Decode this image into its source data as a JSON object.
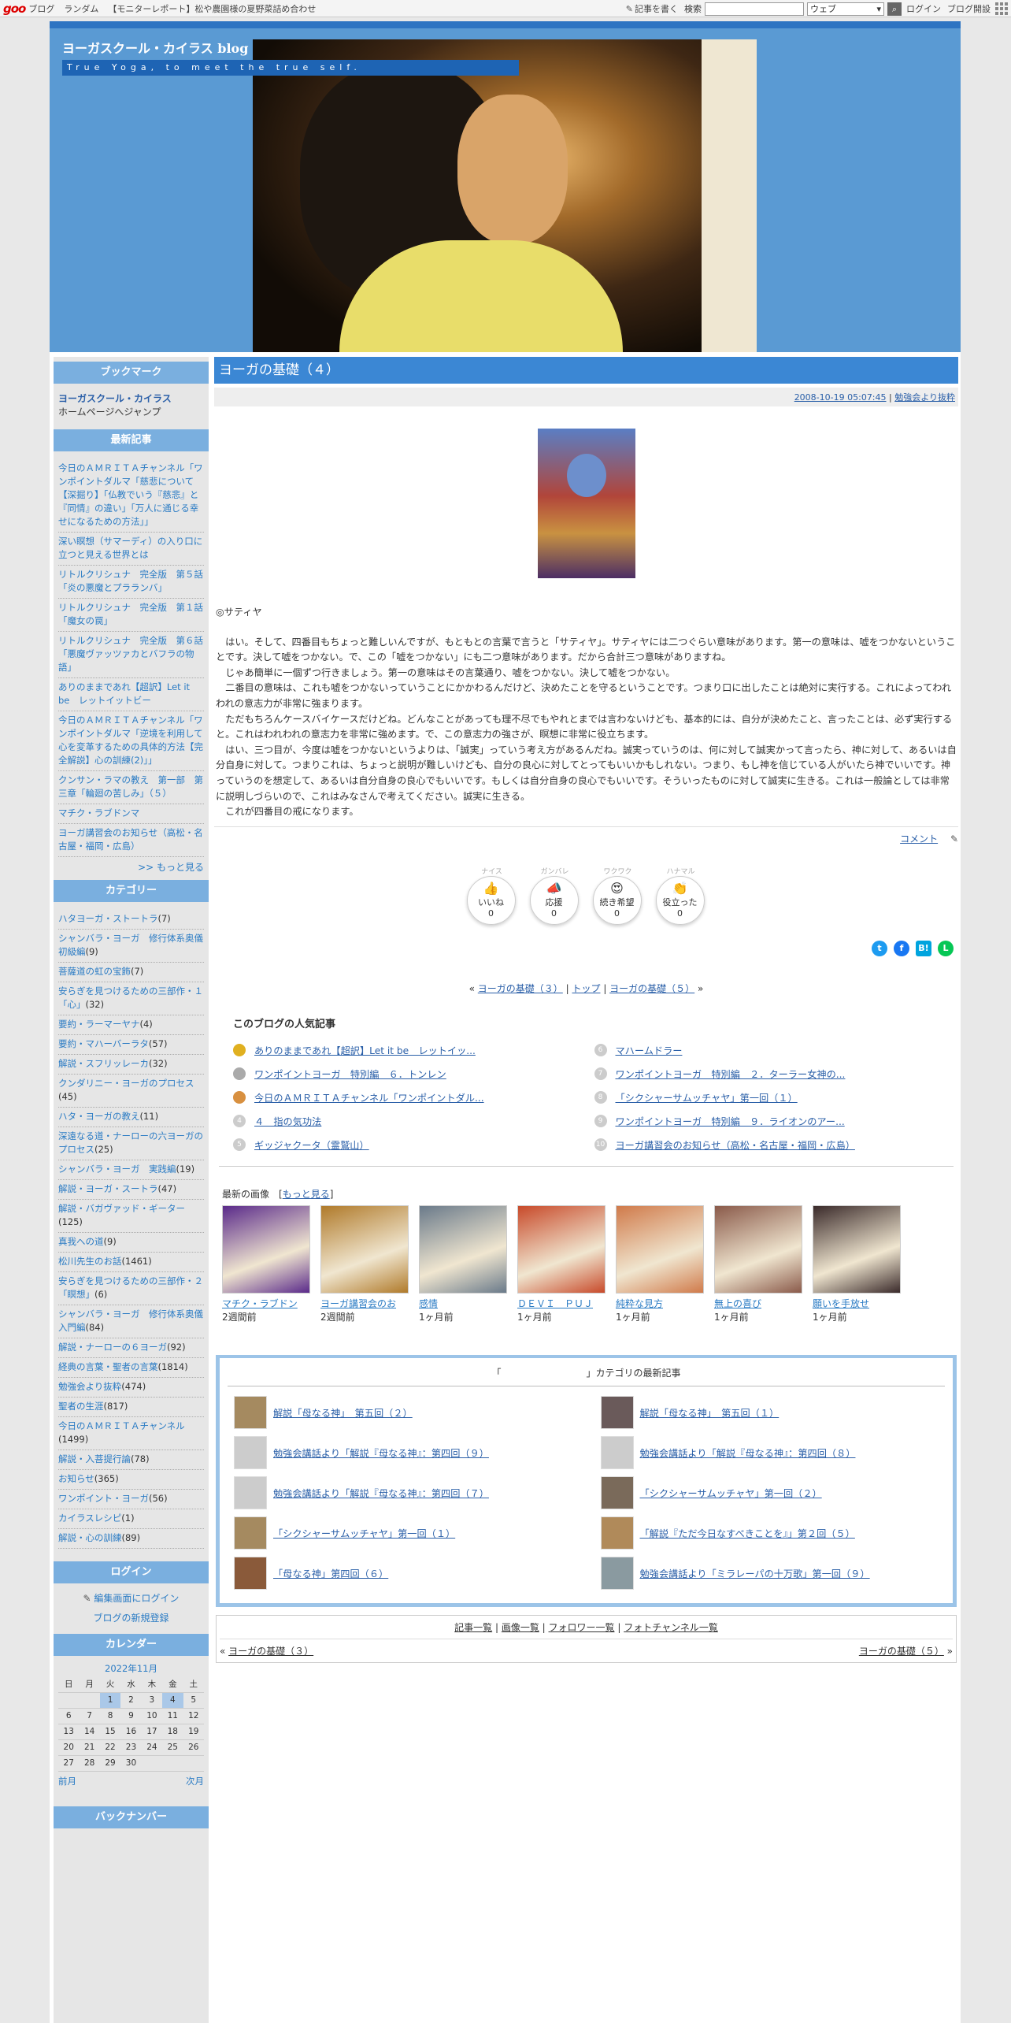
{
  "topbar": {
    "logo": "goo",
    "links": [
      "ブログ",
      "ランダム",
      "【モニターレポート】松や農園様の夏野菜詰め合わせ"
    ],
    "write": "記事を書く",
    "search_label": "検索",
    "search_value": "",
    "select_value": "ウェブ",
    "login": "ログイン",
    "open_blog": "ブログ開設"
  },
  "header": {
    "title": "ヨーガスクール・カイラス blog",
    "subtitle": "True Yoga, to meet the true self."
  },
  "sidebar": {
    "bookmark": {
      "heading": "ブックマーク",
      "link": "ヨーガスクール・カイラス",
      "note": "ホームページへジャンプ"
    },
    "recent": {
      "heading": "最新記事",
      "items": [
        "今日のＡＭＲＩＴＡチャンネル「ワンポイントダルマ「慈悲について【深掘り】「仏教でいう『慈悲』と『同情』の違い」「万人に通じる幸せになるための方法」」",
        "深い瞑想（サマーディ）の入り口に立つと見える世界とは",
        "リトルクリシュナ　完全版　第５話「炎の悪魔とプラランバ」",
        "リトルクリシュナ　完全版　第１話「魔女の罠」",
        "リトルクリシュナ　完全版　第６話「悪魔ヴァッツァカとバフラの物語」",
        "ありのままであれ【超訳】Let it be　レットイットビー",
        "今日のＡＭＲＩＴＡチャンネル「ワンポイントダルマ「逆境を利用して心を変革するための具体的方法【完全解説】心の訓練(2)」」",
        "クンサン・ラマの教え　第一部　第三章「輪廻の苦しみ」（５）",
        "マチク・ラブドンマ",
        "ヨーガ講習会のお知らせ（高松・名古屋・福岡・広島）"
      ],
      "more": ">> もっと見る"
    },
    "categories": {
      "heading": "カテゴリー",
      "items": [
        {
          "name": "ハタヨーガ・ストートラ",
          "count": "(7)"
        },
        {
          "name": "シャンバラ・ヨーガ　修行体系奥儀　初級編",
          "count": "(9)"
        },
        {
          "name": "菩薩道の虹の宝飾",
          "count": "(7)"
        },
        {
          "name": "安らぎを見つけるための三部作・１「心」",
          "count": "(32)"
        },
        {
          "name": "要約・ラーマーヤナ",
          "count": "(4)"
        },
        {
          "name": "要約・マハーバーラタ",
          "count": "(57)"
        },
        {
          "name": "解説・スフリッレーカ",
          "count": "(32)"
        },
        {
          "name": "クンダリニー・ヨーガのプロセス",
          "count": "(45)"
        },
        {
          "name": "ハタ・ヨーガの教え",
          "count": "(11)"
        },
        {
          "name": "深遠なる道・ナーローの六ヨーガのプロセス",
          "count": "(25)"
        },
        {
          "name": "シャンバラ・ヨーガ　実践編",
          "count": "(19)"
        },
        {
          "name": "解説・ヨーガ・スートラ",
          "count": "(47)"
        },
        {
          "name": "解説・バガヴァッド・ギーター",
          "count": "(125)"
        },
        {
          "name": "真我への道",
          "count": "(9)"
        },
        {
          "name": "松川先生のお話",
          "count": "(1461)"
        },
        {
          "name": "安らぎを見つけるための三部作・２「瞑想」",
          "count": "(6)"
        },
        {
          "name": "シャンバラ・ヨーガ　修行体系奥儀　入門編",
          "count": "(84)"
        },
        {
          "name": "解説・ナーローの６ヨーガ",
          "count": "(92)"
        },
        {
          "name": "経典の言葉・聖者の言葉",
          "count": "(1814)"
        },
        {
          "name": "勉強会より抜粋",
          "count": "(474)"
        },
        {
          "name": "聖者の生涯",
          "count": "(817)"
        },
        {
          "name": "今日のＡＭＲＩＴＡチャンネル",
          "count": "(1499)"
        },
        {
          "name": "解説・入菩提行論",
          "count": "(78)"
        },
        {
          "name": "お知らせ",
          "count": "(365)"
        },
        {
          "name": "ワンポイント・ヨーガ",
          "count": "(56)"
        },
        {
          "name": "カイラスレシピ",
          "count": "(1)"
        },
        {
          "name": "解説・心の訓練",
          "count": "(89)"
        }
      ]
    },
    "login": {
      "heading": "ログイン",
      "edit": "編集画面にログイン",
      "register": "ブログの新規登録"
    },
    "calendar": {
      "heading": "カレンダー",
      "month": "2022年11月",
      "weekdays": [
        "日",
        "月",
        "火",
        "水",
        "木",
        "金",
        "土"
      ],
      "weeks": [
        [
          "",
          "",
          "1",
          "2",
          "3",
          "4",
          "5"
        ],
        [
          "6",
          "7",
          "8",
          "9",
          "10",
          "11",
          "12"
        ],
        [
          "13",
          "14",
          "15",
          "16",
          "17",
          "18",
          "19"
        ],
        [
          "20",
          "21",
          "22",
          "23",
          "24",
          "25",
          "26"
        ],
        [
          "27",
          "28",
          "29",
          "30",
          "",
          "",
          ""
        ]
      ],
      "prev": "前月",
      "next": "次月"
    },
    "bottom_heading": "バックナンバー"
  },
  "post": {
    "title": "ヨーガの基礎（４）",
    "datetime": "2008-10-19 05:07:45",
    "category": "勉強会より抜粋",
    "section_title": "◎サティヤ",
    "paragraphs": [
      "　はい。そして、四番目もちょっと難しいんですが、もともとの言葉で言うと「サティヤ」。サティヤには二つぐらい意味があります。第一の意味は、嘘をつかないということです。決して嘘をつかない。で、この「嘘をつかない」にも二つ意味があります。だから合計三つ意味がありますね。",
      "　じゃあ簡単に一個ずつ行きましょう。第一の意味はその言葉通り、嘘をつかない。決して嘘をつかない。",
      "　二番目の意味は、これも嘘をつかないっていうことにかかわるんだけど、決めたことを守るということです。つまり口に出したことは絶対に実行する。これによってわれわれの意志力が非常に強まります。",
      "　ただもちろんケースバイケースだけどね。どんなことがあっても理不尽でもやれとまでは言わないけども、基本的には、自分が決めたこと、言ったことは、必ず実行すると。これはわれわれの意志力を非常に強めます。で、この意志力の強さが、瞑想に非常に役立ちます。",
      "　はい、三つ目が、今度は嘘をつかないというよりは、「誠実」っていう考え方があるんだね。誠実っていうのは、何に対して誠実かって言ったら、神に対して、あるいは自分自身に対して。つまりこれは、ちょっと説明が難しいけども、自分の良心に対してとってもいいかもしれない。つまり、もし神を信じている人がいたら神でいいです。神っていうのを想定して、あるいは自分自身の良心でもいいです。もしくは自分自身の良心でもいいです。そういったものに対して誠実に生きる。これは一般論としては非常に説明しづらいので、これはみなさんで考えてください。誠実に生きる。",
      "　これが四番目の戒になります。"
    ],
    "comment": "コメント",
    "reactions": [
      {
        "top": "ナイス",
        "emoji": "👍",
        "label": "いいね",
        "count": "0"
      },
      {
        "top": "ガンバレ",
        "emoji": "📣",
        "label": "応援",
        "count": "0"
      },
      {
        "top": "ワクワク",
        "emoji": "😍",
        "label": "続き希望",
        "count": "0"
      },
      {
        "top": "ハナマル",
        "emoji": "👏",
        "label": "役立った",
        "count": "0"
      }
    ],
    "share": [
      "t",
      "f",
      "B!",
      "L"
    ],
    "pager": {
      "prev": "ヨーガの基礎（３）",
      "top": "トップ",
      "next": "ヨーガの基礎（５）"
    }
  },
  "popular": {
    "heading": "このブログの人気記事",
    "left": [
      "ありのままであれ【超訳】Let it be　レットイッ...",
      "ワンポイントヨーガ　特別編　６．トンレン",
      "今日のＡＭＲＩＴＡチャンネル「ワンポイントダル...",
      "４　指の気功法",
      "ギッジャクータ（霊鷲山）"
    ],
    "right": [
      "マハームドラー",
      "ワンポイントヨーガ　特別編　２．ターラー女神の...",
      "「シクシャーサムッチャヤ」第一回（１）",
      "ワンポイントヨーガ　特別編　９．ライオンのアー...",
      "ヨーガ講習会のお知らせ（高松・名古屋・福岡・広島）"
    ],
    "ranks_left": [
      "",
      "",
      "",
      "4",
      "5"
    ],
    "ranks_right": [
      "6",
      "7",
      "8",
      "9",
      "10"
    ]
  },
  "images": {
    "heading": "最新の画像",
    "more": "もっと見る",
    "items": [
      {
        "title": "マチク・ラブドン",
        "age": "2週間前",
        "color": "#5a2a8a"
      },
      {
        "title": "ヨーガ講習会のお",
        "age": "2週間前",
        "color": "#b07a2a"
      },
      {
        "title": "感情",
        "age": "1ヶ月前",
        "color": "#6a7a8a"
      },
      {
        "title": "ＤＥＶＩ　ＰＵＪ",
        "age": "1ヶ月前",
        "color": "#c84a2a"
      },
      {
        "title": "純粋な見方",
        "age": "1ヶ月前",
        "color": "#d07a4a"
      },
      {
        "title": "無上の喜び",
        "age": "1ヶ月前",
        "color": "#8a5a4a"
      },
      {
        "title": "願いを手放せ",
        "age": "1ヶ月前",
        "color": "#3a2a2a"
      }
    ]
  },
  "category_latest": {
    "heading": "「　　　　　　　　　」カテゴリの最新記事",
    "left": [
      "解説「母なる神」　第五回（２）",
      "勉強会講話より「解説『母なる神』：第四回（９）",
      "勉強会講話より「解説『母なる神』：第四回（７）",
      "「シクシャーサムッチャヤ」第一回（１）",
      "「母なる神」第四回（６）"
    ],
    "right": [
      "解説「母なる神」　第五回（１）",
      "勉強会講話より「解説『母なる神』：第四回（８）",
      "「シクシャーサムッチャヤ」第一回（２）",
      "「解説『ただ今日なすべきことを』」第２回（５）",
      "勉強会講話より「ミラレーパの十万歌」第一回（９）"
    ]
  },
  "footer": {
    "links": [
      "記事一覧",
      "画像一覧",
      "フォロワー一覧",
      "フォトチャンネル一覧"
    ],
    "prev": "ヨーガの基礎（３）",
    "next": "ヨーガの基礎（５）"
  }
}
